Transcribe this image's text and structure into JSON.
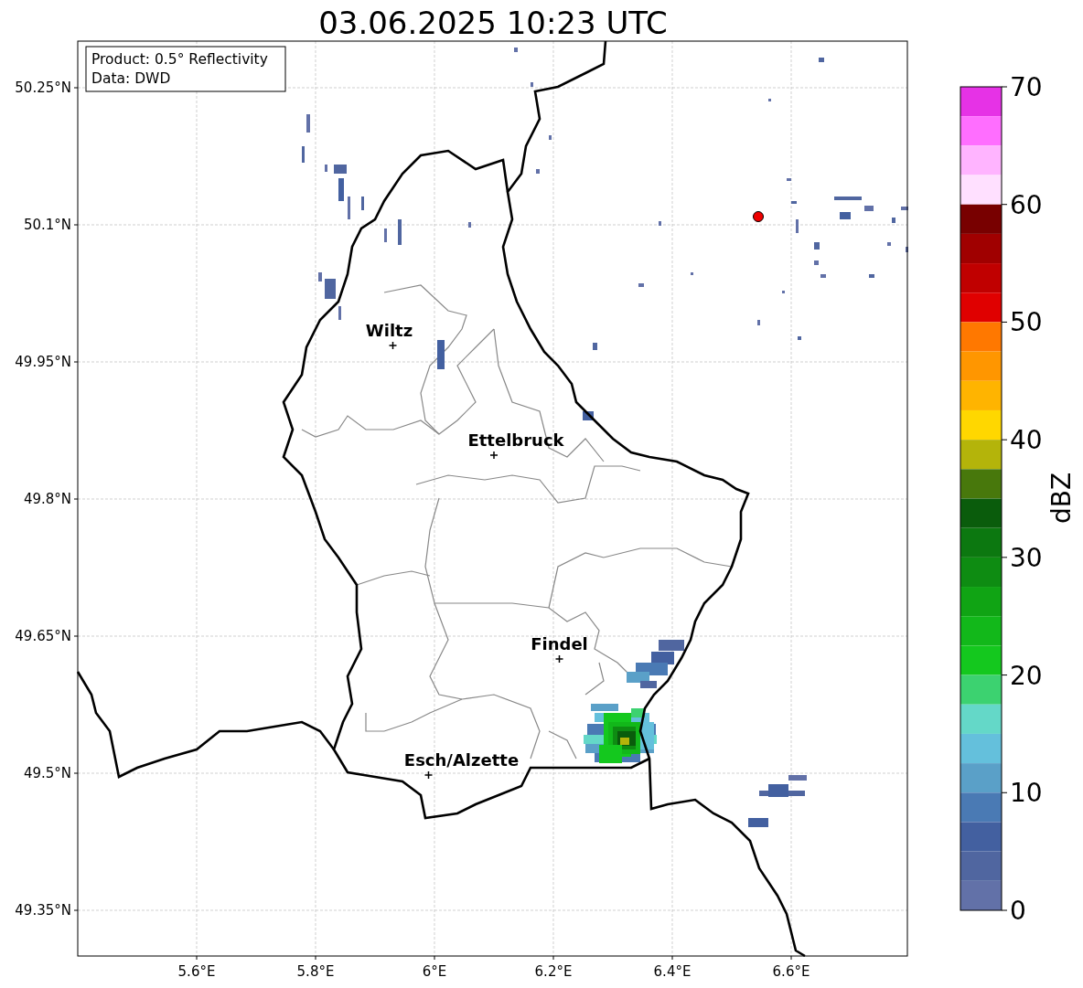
{
  "title": "03.06.2025 10:23 UTC",
  "info_box": [
    "Product: 0.5° Reflectivity",
    "Data: DWD"
  ],
  "cities": [
    "Wiltz",
    "Ettelbruck",
    "Findel",
    "Esch/Alzette"
  ],
  "x_ticks": [
    "5.6°E",
    "5.8°E",
    "6°E",
    "6.2°E",
    "6.4°E",
    "6.6°E"
  ],
  "y_ticks": [
    "50.25°N",
    "50.1°N",
    "49.95°N",
    "49.8°N",
    "49.65°N",
    "49.5°N",
    "49.35°N"
  ],
  "colorbar": {
    "label": "dBZ",
    "ticks": [
      "70",
      "60",
      "50",
      "40",
      "30",
      "20",
      "10",
      "0"
    ],
    "bins": [
      {
        "color": "#e632e6"
      },
      {
        "color": "#ff6eff"
      },
      {
        "color": "#ffb4ff"
      },
      {
        "color": "#ffe0ff"
      },
      {
        "color": "#780000"
      },
      {
        "color": "#a00000"
      },
      {
        "color": "#c00000"
      },
      {
        "color": "#e00000"
      },
      {
        "color": "#ff7800"
      },
      {
        "color": "#ff9600"
      },
      {
        "color": "#ffb400"
      },
      {
        "color": "#ffd700"
      },
      {
        "color": "#b4b40a"
      },
      {
        "color": "#48780c"
      },
      {
        "color": "#0a5c0c"
      },
      {
        "color": "#0c7810"
      },
      {
        "color": "#0e8c12"
      },
      {
        "color": "#10a414"
      },
      {
        "color": "#12b81a"
      },
      {
        "color": "#14c81e"
      },
      {
        "color": "#3cd270"
      },
      {
        "color": "#64d8c8"
      },
      {
        "color": "#64c0dc"
      },
      {
        "color": "#5aa0c8"
      },
      {
        "color": "#4a7ab4"
      },
      {
        "color": "#4360a0"
      },
      {
        "color": "#5066a0"
      },
      {
        "color": "#6271a8"
      }
    ]
  }
}
